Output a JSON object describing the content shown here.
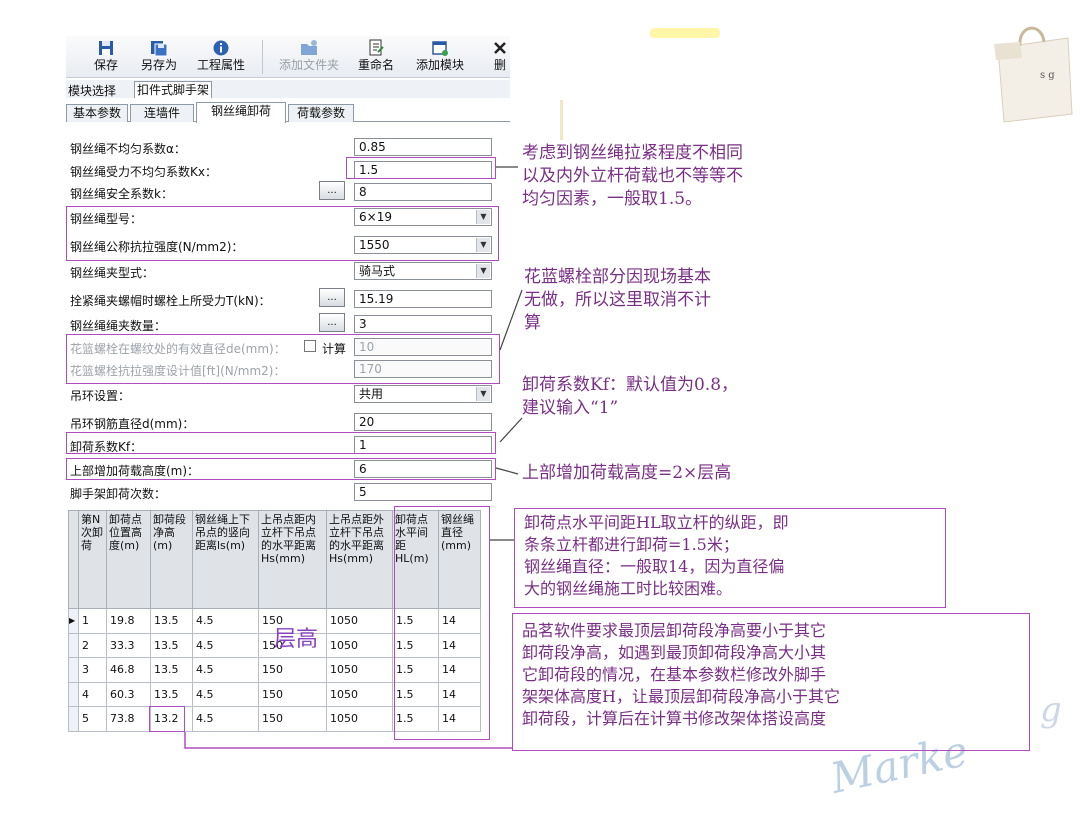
{
  "toolbar": {
    "buttons": [
      {
        "label": "保存",
        "icon": "save-icon",
        "enabled": true
      },
      {
        "label": "另存为",
        "icon": "save-as-icon",
        "enabled": true
      },
      {
        "label": "工程属性",
        "icon": "info-icon",
        "enabled": true
      },
      {
        "label": "添加文件夹",
        "icon": "add-folder-icon",
        "enabled": false
      },
      {
        "label": "重命名",
        "icon": "rename-icon",
        "enabled": true
      },
      {
        "label": "添加模块",
        "icon": "add-module-icon",
        "enabled": true
      },
      {
        "label": "删",
        "icon": "delete-icon",
        "enabled": true
      }
    ]
  },
  "module": {
    "label": "模块选择",
    "selected": "扣件式脚手架"
  },
  "tabs": [
    {
      "label": "基本参数",
      "active": false
    },
    {
      "label": "连墙件",
      "active": false
    },
    {
      "label": "钢丝绳卸荷",
      "active": true
    },
    {
      "label": "荷载参数",
      "active": false
    }
  ],
  "form": {
    "alpha": {
      "label": "钢丝绳不均匀系数α：",
      "value": "0.85"
    },
    "kx": {
      "label": "钢丝绳受力不均匀系数Kx：",
      "value": "1.5"
    },
    "k": {
      "label": "钢丝绳安全系数k：",
      "value": "8",
      "button": "..."
    },
    "rope_type": {
      "label": "钢丝绳型号：",
      "value": "6×19"
    },
    "tensile": {
      "label": "钢丝绳公称抗拉强度(N/mm2)：",
      "value": "1550"
    },
    "clamp_type": {
      "label": "钢丝绳夹型式：",
      "value": "骑马式"
    },
    "clamp_force": {
      "label": "拴紧绳夹螺帽时螺栓上所受力T(kN)：",
      "value": "15.19",
      "button": "..."
    },
    "clamp_count": {
      "label": "钢丝绳绳夹数量：",
      "value": "3",
      "button": "..."
    },
    "bolt_diameter": {
      "label": "花篮螺栓在螺纹处的有效直径de(mm)：",
      "value": "10",
      "checkbox_label": "计算"
    },
    "bolt_strength": {
      "label": "花篮螺栓抗拉强度设计值[ft](N/mm2)：",
      "value": "170"
    },
    "ring": {
      "label": "吊环设置：",
      "value": "共用"
    },
    "ring_diameter": {
      "label": "吊环钢筋直径d(mm)：",
      "value": "20"
    },
    "kf": {
      "label": "卸荷系数Kf：",
      "value": "1"
    },
    "extra_height": {
      "label": "上部增加荷载高度(m)：",
      "value": "6"
    },
    "unload_times": {
      "label": "脚手架卸荷次数：",
      "value": "5"
    }
  },
  "table": {
    "headers": [
      "第N次卸荷",
      "卸荷点位置高度(m)",
      "卸荷段净高(m)",
      "钢丝绳上下吊点的竖向距离ls(m)",
      "上吊点距内立杆下吊点的水平距离Hs(mm)",
      "上吊点距外立杆下吊点的水平距离Hs(mm)",
      "卸荷点水平间距HL(m)",
      "钢丝绳直径(mm)"
    ],
    "rows": [
      [
        "1",
        "19.8",
        "13.5",
        "4.5",
        "150",
        "1050",
        "1.5",
        "14"
      ],
      [
        "2",
        "33.3",
        "13.5",
        "4.5",
        "150",
        "1050",
        "1.5",
        "14"
      ],
      [
        "3",
        "46.8",
        "13.5",
        "4.5",
        "150",
        "1050",
        "1.5",
        "14"
      ],
      [
        "4",
        "60.3",
        "13.5",
        "4.5",
        "150",
        "1050",
        "1.5",
        "14"
      ],
      [
        "5",
        "73.8",
        "13.2",
        "4.5",
        "150",
        "1050",
        "1.5",
        "14"
      ]
    ]
  },
  "annotations": {
    "layer_height": "层高",
    "note_kx": [
      "考虑到钢丝绳拉紧程度不相同",
      "以及内外立杆荷载也不等等不",
      "均匀因素，一般取1.5。"
    ],
    "note_bolt": [
      "花蓝螺栓部分因现场基本",
      "无做，所以这里取消不计",
      "算"
    ],
    "note_kf": [
      "卸荷系数Kf：默认值为0.8，",
      "建议输入“1”"
    ],
    "note_height": "上部增加荷载高度=2×层高",
    "note_hl": [
      "卸荷点水平间距HL取立杆的纵距，即",
      "条条立杆都进行卸荷=1.5米；",
      "钢丝绳直径：一般取14，因为直径偏",
      "大的钢丝绳施工时比较困难。"
    ],
    "note_top": [
      "品茗软件要求最顶层卸荷段净高要小于其它",
      "卸荷段净高，如遇到最顶卸荷段净高大小其",
      "它卸荷段的情况，在基本参数栏修改外脚手",
      "架架体高度H，让最顶层卸荷段净高小于其它",
      "卸荷段，计算后在计算书修改架体搭设高度"
    ]
  },
  "decor": {
    "bag_text": "s g",
    "watermark": "Marke",
    "watermark_g": "g"
  },
  "colors": {
    "annotation": "#b14bc0",
    "annotation_text": "#7a2f86",
    "accent": "#2b6cb0"
  }
}
